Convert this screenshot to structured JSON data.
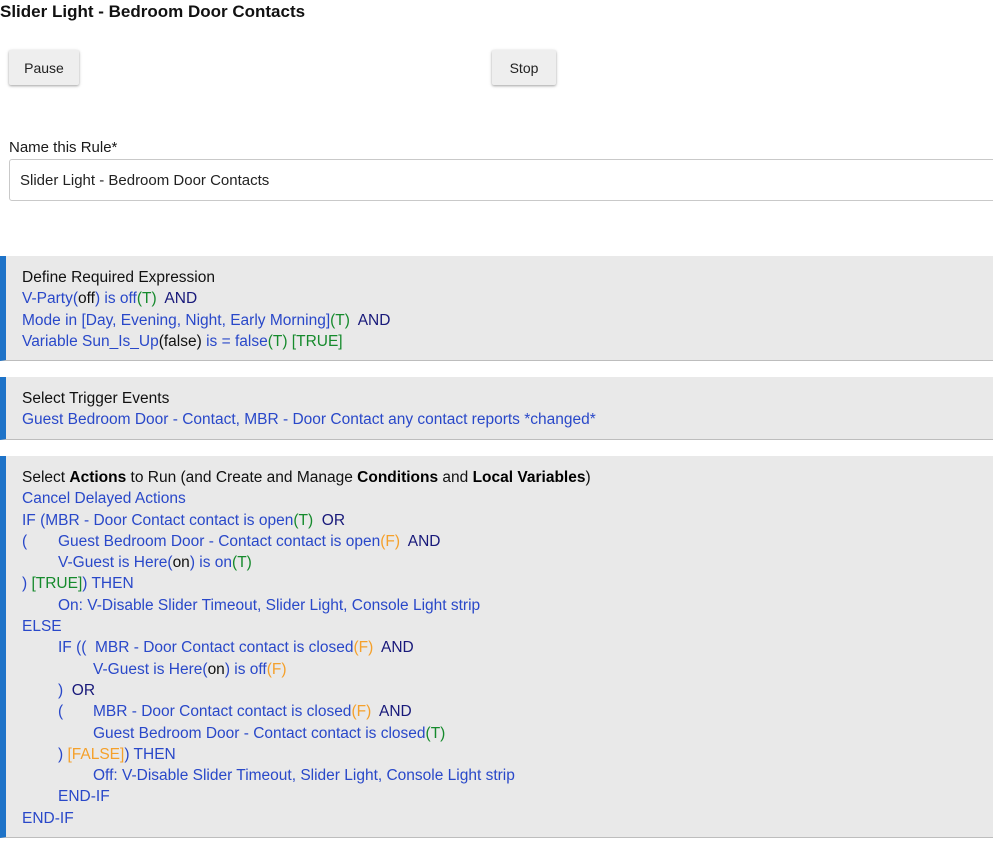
{
  "page": {
    "title": "Slider Light - Bedroom Door Contacts"
  },
  "buttons": {
    "pause": "Pause",
    "stop": "Stop"
  },
  "name_field": {
    "label": "Name this Rule*",
    "value": "Slider Light - Bedroom Door Contacts"
  },
  "expression": {
    "title": "Define Required Expression",
    "l1": {
      "a": "V-Party(",
      "b": "off",
      "c": ") is off",
      "d": "(T)",
      "e": "  AND"
    },
    "l2": {
      "a": "Mode in [Day, Evening, Night, Early Morning]",
      "b": "(T)",
      "c": "  AND"
    },
    "l3": {
      "a": "Variable Sun_Is_Up",
      "b": "(false)",
      "c": " is = false",
      "d": "(T) [TRUE]"
    }
  },
  "triggers": {
    "title": "Select Trigger Events",
    "text": "Guest Bedroom Door - Contact, MBR - Door Contact any contact reports *changed*"
  },
  "actions": {
    "title": {
      "p1": "Select ",
      "b1": "Actions",
      "p2": " to Run (and Create and Manage ",
      "b2": "Conditions",
      "p3": " and ",
      "b3": "Local Variables",
      "p4": ")"
    },
    "l1": {
      "a": "Cancel Delayed Actions"
    },
    "l2": {
      "a": "IF (MBR - Door Contact contact is open",
      "b": "(T)",
      "c": "  OR"
    },
    "l3": {
      "a": "(",
      "b": "Guest Bedroom Door - Contact contact is open",
      "c": "(F)",
      "d": "  AND"
    },
    "l4": {
      "a": "V-Guest is Here(",
      "b": "on",
      "c": ") is on",
      "d": "(T)"
    },
    "l5": {
      "a": ") ",
      "b": "[TRUE]",
      "c": ") THEN"
    },
    "l6": {
      "a": "On: V-Disable Slider Timeout, Slider Light, Console Light strip"
    },
    "l7": {
      "a": "ELSE"
    },
    "l8": {
      "a": "IF ((  MBR - Door Contact contact is closed",
      "b": "(F)",
      "c": "  AND"
    },
    "l9": {
      "a": "V-Guest is Here(",
      "b": "on",
      "c": ") is off",
      "d": "(F)"
    },
    "l10": {
      "a": ")",
      "b": "  OR"
    },
    "l11": {
      "a": "(",
      "b": "MBR - Door Contact contact is closed",
      "c": "(F)",
      "d": "  AND"
    },
    "l12": {
      "a": "Guest Bedroom Door - Contact contact is closed",
      "b": "(T)"
    },
    "l13": {
      "a": ") ",
      "b": "[FALSE]",
      "c": ") THEN"
    },
    "l14": {
      "a": "Off: V-Disable Slider Timeout, Slider Light, Console Light strip"
    },
    "l15": {
      "a": "END-IF"
    },
    "l16": {
      "a": "END-IF"
    }
  },
  "colors": {
    "link_blue": "#2948c9",
    "true_green": "#158a2c",
    "false_orange": "#f5a02a",
    "operator_navy": "#18197a",
    "section_accent": "#1e73c8",
    "section_bg": "#e9e9e9"
  }
}
